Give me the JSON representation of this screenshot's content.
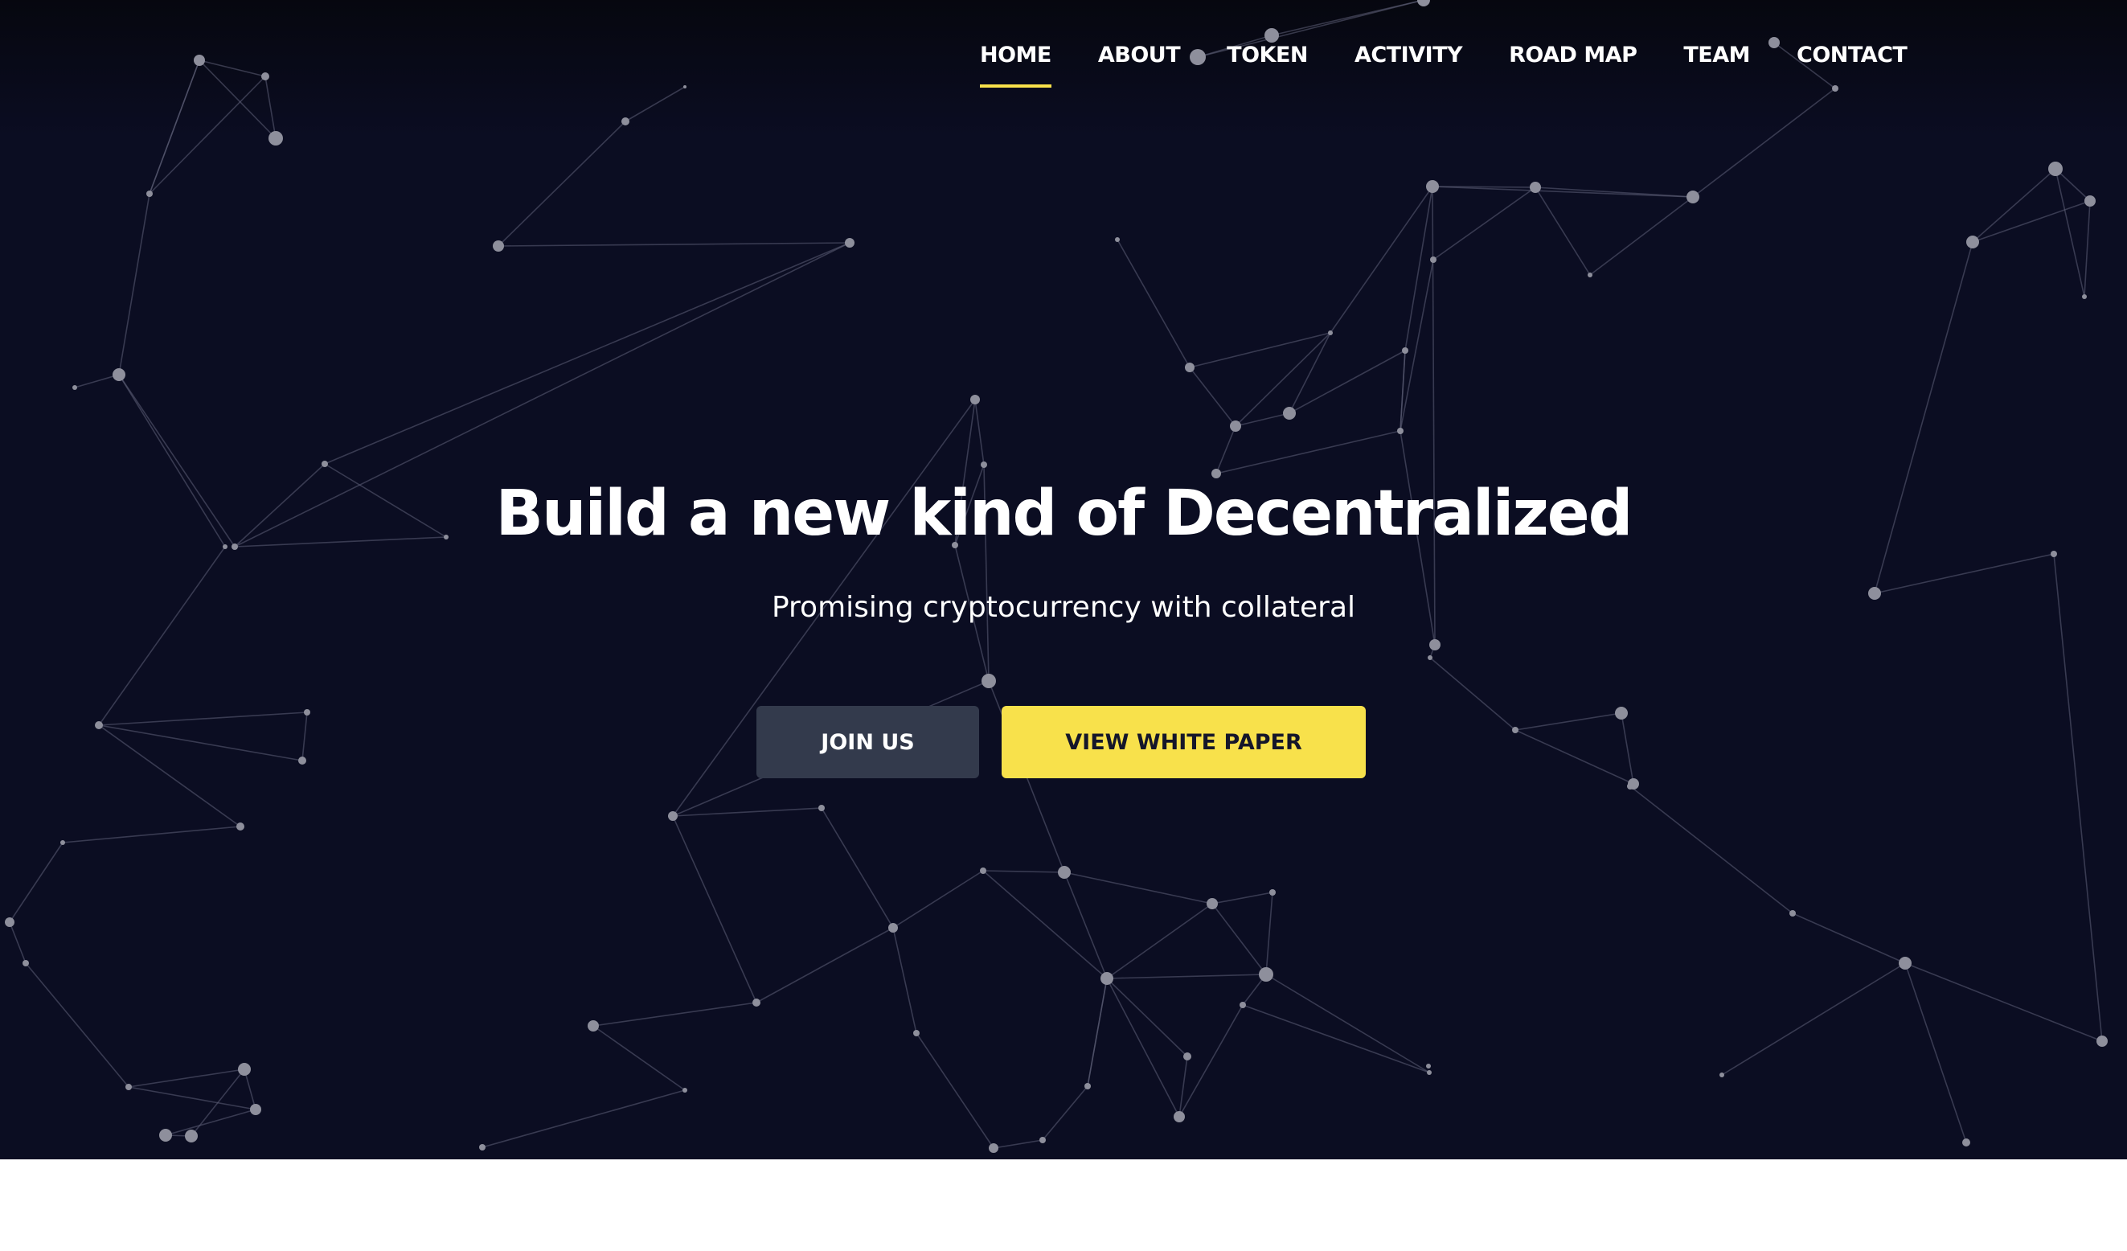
{
  "nav": {
    "items": [
      {
        "label": "HOME",
        "active": true
      },
      {
        "label": "ABOUT",
        "active": false
      },
      {
        "label": "TOKEN",
        "active": false
      },
      {
        "label": "ACTIVITY",
        "active": false
      },
      {
        "label": "ROAD MAP",
        "active": false
      },
      {
        "label": "TEAM",
        "active": false
      },
      {
        "label": "CONTACT",
        "active": false
      }
    ]
  },
  "hero": {
    "headline": "Build a new kind of Decentralized",
    "subtitle": "Promising cryptocurrency with collateral",
    "join_button": "JOIN US",
    "whitepaper_button": "VIEW WHITE PAPER"
  },
  "colors": {
    "background": "#0b0d22",
    "accent": "#f8e14b",
    "secondary_button": "#333a4c",
    "network_node": "#8e8f9c"
  }
}
